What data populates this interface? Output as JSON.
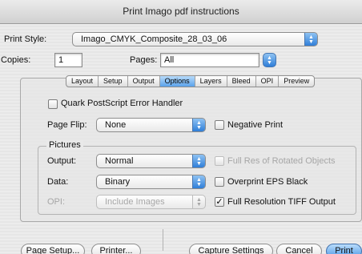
{
  "window": {
    "title": "Print Imago pdf instructions"
  },
  "print_style": {
    "label": "Print Style:",
    "value": "Imago_CMYK_Composite_28_03_06"
  },
  "copies": {
    "label": "Copies:",
    "value": "1"
  },
  "pages": {
    "label": "Pages:",
    "value": "All"
  },
  "tabs": [
    {
      "label": "Layout",
      "selected": false
    },
    {
      "label": "Setup",
      "selected": false
    },
    {
      "label": "Output",
      "selected": false
    },
    {
      "label": "Options",
      "selected": true
    },
    {
      "label": "Layers",
      "selected": false
    },
    {
      "label": "Bleed",
      "selected": false
    },
    {
      "label": "OPI",
      "selected": false
    },
    {
      "label": "Preview",
      "selected": false
    }
  ],
  "options": {
    "quark_error_handler": {
      "label": "Quark PostScript Error Handler",
      "checked": false
    },
    "page_flip": {
      "label": "Page Flip:",
      "value": "None"
    },
    "negative_print": {
      "label": "Negative Print",
      "checked": false
    },
    "pictures": {
      "title": "Pictures",
      "output": {
        "label": "Output:",
        "value": "Normal"
      },
      "data": {
        "label": "Data:",
        "value": "Binary"
      },
      "opi": {
        "label": "OPI:",
        "value": "Include Images",
        "enabled": false
      },
      "full_res_rotated": {
        "label": "Full Res of Rotated Objects",
        "checked": false,
        "enabled": false
      },
      "overprint_eps_black": {
        "label": "Overprint EPS Black",
        "checked": false
      },
      "full_res_tiff": {
        "label": "Full Resolution TIFF Output",
        "checked": true
      }
    }
  },
  "buttons": {
    "page_setup": "Page Setup...",
    "printer": "Printer...",
    "capture_settings": "Capture Settings",
    "cancel": "Cancel",
    "print": "Print"
  },
  "glyphs": {
    "popup_arrows": "▲▼",
    "check_mark": "✓"
  }
}
